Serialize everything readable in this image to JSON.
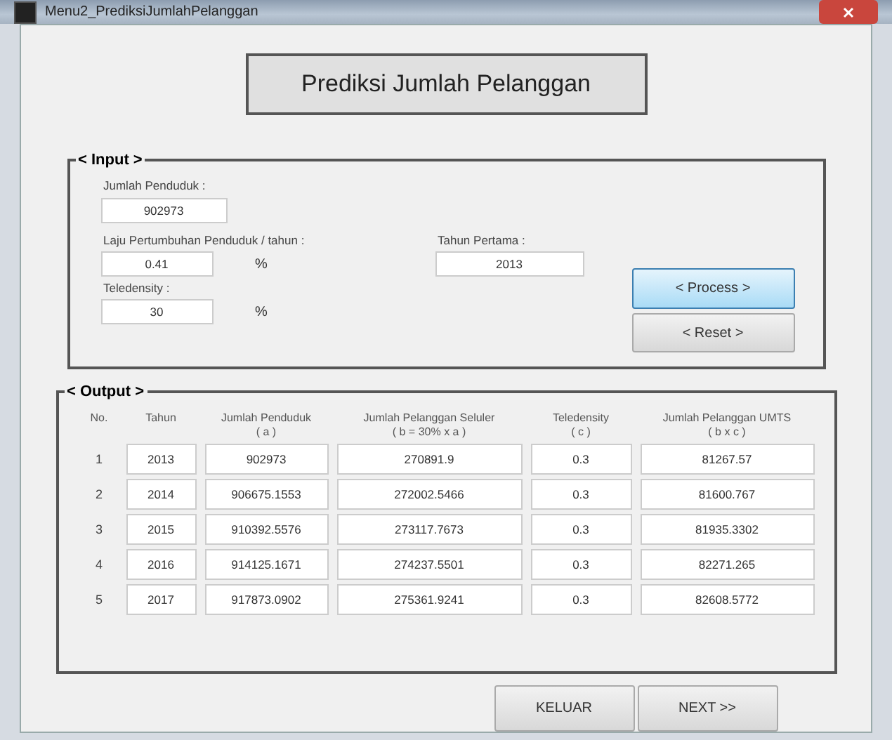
{
  "window": {
    "title": "Menu2_PrediksiJumlahPelanggan"
  },
  "heading": "Prediksi Jumlah Pelanggan",
  "input_panel": {
    "title": "< Input >",
    "jumlah_penduduk": {
      "label": "Jumlah Penduduk :",
      "value": "902973"
    },
    "laju": {
      "label": "Laju Pertumbuhan Penduduk / tahun :",
      "value": "0.41",
      "unit": "%"
    },
    "teledensity": {
      "label": "Teledensity :",
      "value": "30",
      "unit": "%"
    },
    "tahun_pertama": {
      "label": "Tahun Pertama :",
      "value": "2013"
    },
    "buttons": [
      {
        "label": "< Process >",
        "focused": true
      },
      {
        "label": "< Reset >",
        "focused": false
      }
    ]
  },
  "output_panel": {
    "title": "< Output >",
    "columns": [
      {
        "title": "No."
      },
      {
        "title": "Tahun"
      },
      {
        "title": "Jumlah Penduduk",
        "sub": "( a )"
      },
      {
        "title": "Jumlah Pelanggan Seluler",
        "sub": "( b = 30% x a )"
      },
      {
        "title": "Teledensity",
        "sub": "( c )"
      },
      {
        "title": "Jumlah Pelanggan UMTS",
        "sub": "( b x c )"
      }
    ],
    "rows": [
      [
        "1",
        "2013",
        "902973",
        "270891.9",
        "0.3",
        "81267.57"
      ],
      [
        "2",
        "2014",
        "906675.1553",
        "272002.5466",
        "0.3",
        "81600.767"
      ],
      [
        "3",
        "2015",
        "910392.5576",
        "273117.7673",
        "0.3",
        "81935.3302"
      ],
      [
        "4",
        "2016",
        "914125.1671",
        "274237.5501",
        "0.3",
        "82271.265"
      ],
      [
        "5",
        "2017",
        "917873.0902",
        "275361.9241",
        "0.3",
        "82608.5772"
      ]
    ]
  },
  "footer_buttons": [
    "KELUAR",
    "NEXT >>"
  ]
}
